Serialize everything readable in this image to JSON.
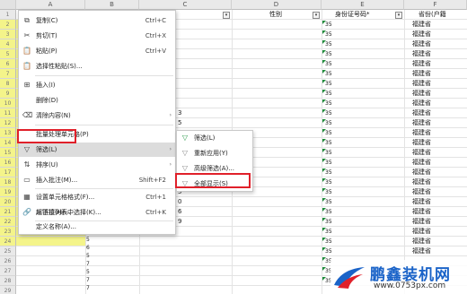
{
  "sheet": {
    "columns": [
      "A",
      "B",
      "C",
      "D",
      "E",
      "F"
    ],
    "row_numbers": [
      "1",
      "2",
      "3",
      "4",
      "5",
      "6",
      "7",
      "8",
      "9",
      "10",
      "11",
      "12",
      "13",
      "14",
      "15",
      "16",
      "17",
      "18",
      "19",
      "20",
      "21",
      "22",
      "23",
      "24",
      "25",
      "26",
      "27",
      "28",
      "29"
    ],
    "header_row": {
      "D": "性别",
      "E": "身份证号码*",
      "F": "省份(户籍"
    },
    "e_values": [
      "35",
      "35",
      "35",
      "35",
      "35",
      "35",
      "35",
      "35",
      "35",
      "35",
      "35",
      "35",
      "35",
      "35",
      "35",
      "35",
      "35",
      "35",
      "35",
      "35",
      "35",
      "35",
      "35",
      "35",
      "35",
      "35",
      "35"
    ],
    "f_values": [
      "福建省",
      "福建省",
      "福建省",
      "福建省",
      "福建省",
      "福建省",
      "福建省",
      "福建省",
      "福建省",
      "福建省",
      "福建省",
      "福建省",
      "福建省",
      "福建省",
      "福建省",
      "福建省",
      "福建省",
      "福建省",
      "福建省",
      "福建省",
      "福建省",
      "福建省",
      "福建省",
      "福建省"
    ],
    "b_values": [
      "3",
      "5",
      "3",
      "5",
      "5",
      "5",
      "3",
      "6",
      "5",
      "0",
      "6",
      "9"
    ],
    "b_values_lower": [
      "5",
      "5",
      "6",
      "5",
      "7",
      "5",
      "7",
      "7"
    ]
  },
  "context_menu": {
    "items": [
      {
        "icon": "⧉",
        "label": "复制(C)",
        "shortcut": "Ctrl+C"
      },
      {
        "icon": "✂",
        "label": "剪切(T)",
        "shortcut": "Ctrl+X"
      },
      {
        "icon": "📋",
        "label": "粘贴(P)",
        "shortcut": "Ctrl+V"
      },
      {
        "icon": "📋",
        "label": "选择性粘贴(S)...",
        "shortcut": ""
      },
      {
        "icon": "⊞",
        "label": "插入(I)",
        "shortcut": ""
      },
      {
        "icon": "",
        "label": "删除(D)",
        "shortcut": ""
      },
      {
        "icon": "⌫",
        "label": "清除内容(N)",
        "shortcut": ""
      },
      {
        "icon": "",
        "label": "批量处理单元格(P)",
        "shortcut": ""
      },
      {
        "icon": "▽",
        "label": "筛选(L)",
        "shortcut": ""
      },
      {
        "icon": "⇅",
        "label": "排序(U)",
        "shortcut": ""
      },
      {
        "icon": "▭",
        "label": "插入批注(M)...",
        "shortcut": "Shift+F2"
      },
      {
        "icon": "▦",
        "label": "设置单元格格式(F)...",
        "shortcut": "Ctrl+1"
      },
      {
        "icon": "",
        "label": "从下拉列表中选择(K)...",
        "shortcut": ""
      },
      {
        "icon": "🔗",
        "label": "超链接(H)...",
        "shortcut": "Ctrl+K"
      },
      {
        "icon": "",
        "label": "定义名称(A)...",
        "shortcut": ""
      }
    ]
  },
  "submenu": {
    "items": [
      {
        "label": "筛选(L)"
      },
      {
        "label": "重新应用(Y)"
      },
      {
        "label": "高级筛选(A)..."
      },
      {
        "label": "全部显示(S)"
      }
    ]
  },
  "watermark": {
    "brand": "鹏鑫装机网",
    "url": "www.0753px.com"
  },
  "colors": {
    "accent_green": "#2a9a4a",
    "highlight_red": "#e0202a",
    "row_yellow": "#f4f48a",
    "brand_blue": "#1a63c8"
  }
}
